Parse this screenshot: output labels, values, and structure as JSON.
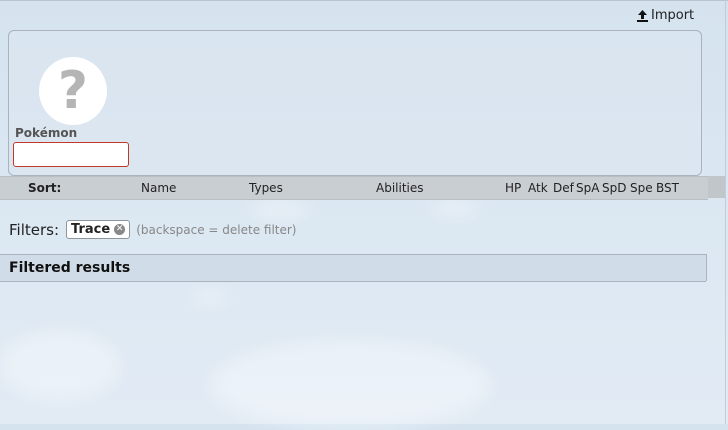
{
  "toolbar": {
    "import_label": "Import"
  },
  "set": {
    "pokemon_label": "Pokémon",
    "pokemon_value": ""
  },
  "sort": {
    "label": "Sort:",
    "columns": [
      "Name",
      "Types",
      "Abilities",
      "HP",
      "Atk",
      "Def",
      "SpA",
      "SpD",
      "Spe",
      "BST"
    ]
  },
  "filters": {
    "label": "Filters:",
    "active": [
      "Trace"
    ],
    "hint": "(backspace = delete filter)"
  },
  "results": {
    "header": "Filtered results"
  },
  "icons": {
    "import": "upload-icon",
    "placeholder": "question-mark-icon",
    "remove_filter": "close-circle-icon"
  }
}
